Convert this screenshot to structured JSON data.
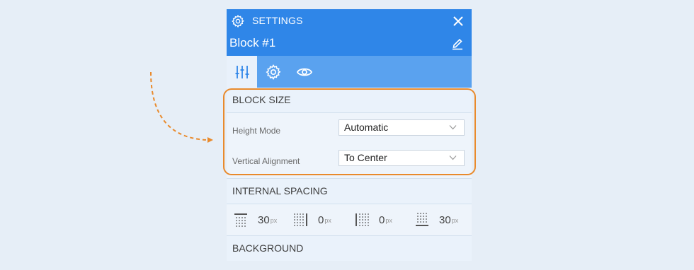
{
  "header": {
    "title": "SETTINGS",
    "block_name": "Block #1"
  },
  "tabs": [
    {
      "icon": "sliders-icon",
      "active": true
    },
    {
      "icon": "gear-icon",
      "active": false
    },
    {
      "icon": "eye-icon",
      "active": false
    }
  ],
  "block_size": {
    "title": "BLOCK SIZE",
    "height_mode_label": "Height Mode",
    "height_mode_value": "Automatic",
    "vertical_alignment_label": "Vertical Alignment",
    "vertical_alignment_value": "To Center"
  },
  "internal_spacing": {
    "title": "INTERNAL SPACING",
    "items": [
      {
        "side": "top",
        "value": "30",
        "unit": "px"
      },
      {
        "side": "right",
        "value": "0",
        "unit": "px"
      },
      {
        "side": "left",
        "value": "0",
        "unit": "px"
      },
      {
        "side": "bottom",
        "value": "30",
        "unit": "px"
      }
    ]
  },
  "background": {
    "title": "BACKGROUND"
  },
  "colors": {
    "header": "#2f86e8",
    "tabs": "#5aa2ef",
    "highlight": "#e98a2c"
  }
}
